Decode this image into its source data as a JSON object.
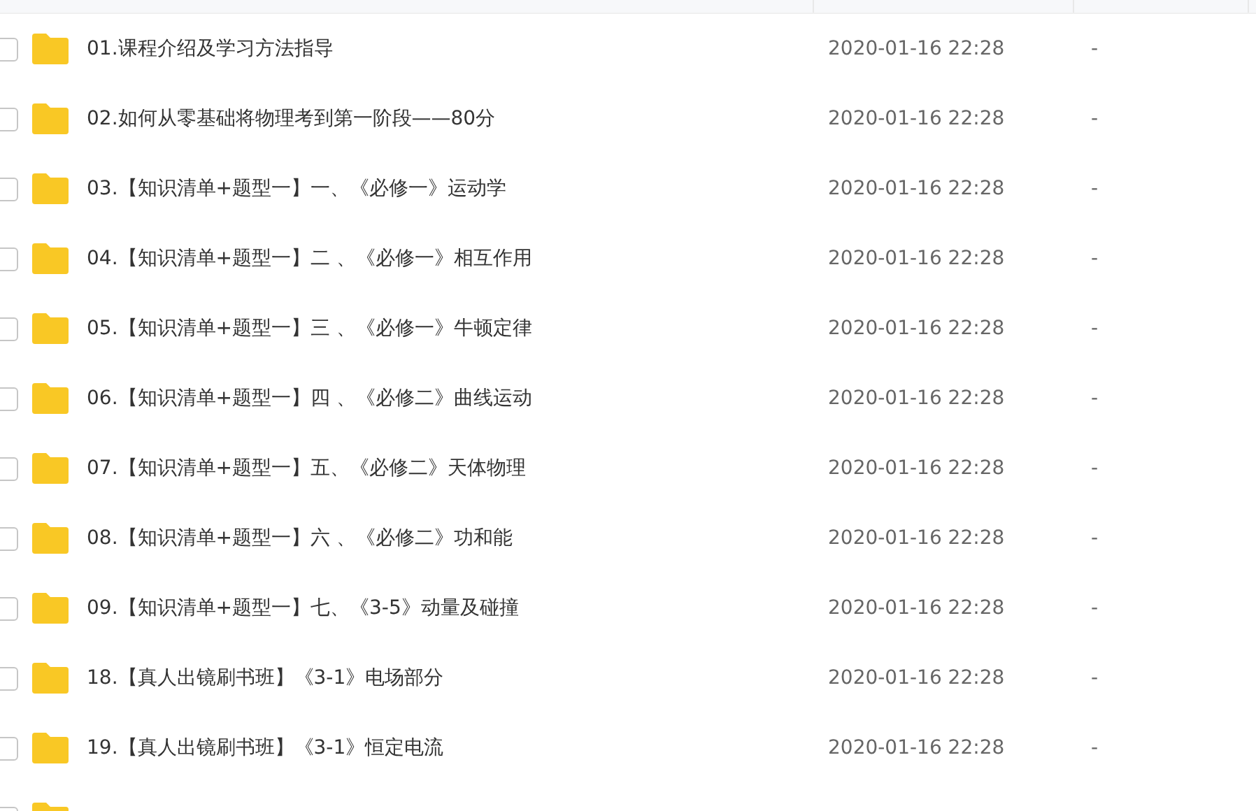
{
  "rows": [
    {
      "name": "01.课程介绍及学习方法指导",
      "modified": "2020-01-16 22:28",
      "size": "-",
      "checked": false
    },
    {
      "name": "02.如何从零基础将物理考到第一阶段——80分",
      "modified": "2020-01-16 22:28",
      "size": "-",
      "checked": false
    },
    {
      "name": "03.【知识清单+题型一】一、《必修一》运动学",
      "modified": "2020-01-16 22:28",
      "size": "-",
      "checked": false
    },
    {
      "name": "04.【知识清单+题型一】二 、《必修一》相互作用",
      "modified": "2020-01-16 22:28",
      "size": "-",
      "checked": false
    },
    {
      "name": "05.【知识清单+题型一】三 、《必修一》牛顿定律",
      "modified": "2020-01-16 22:28",
      "size": "-",
      "checked": false
    },
    {
      "name": "06.【知识清单+题型一】四 、《必修二》曲线运动",
      "modified": "2020-01-16 22:28",
      "size": "-",
      "checked": false
    },
    {
      "name": "07.【知识清单+题型一】五、《必修二》天体物理",
      "modified": "2020-01-16 22:28",
      "size": "-",
      "checked": false
    },
    {
      "name": "08.【知识清单+题型一】六 、《必修二》功和能",
      "modified": "2020-01-16 22:28",
      "size": "-",
      "checked": false
    },
    {
      "name": "09.【知识清单+题型一】七、《3-5》动量及碰撞",
      "modified": "2020-01-16 22:28",
      "size": "-",
      "checked": false
    },
    {
      "name": "18.【真人出镜刷书班】《3-1》电场部分",
      "modified": "2020-01-16 22:28",
      "size": "-",
      "checked": false
    },
    {
      "name": "19.【真人出镜刷书班】《3-1》恒定电流",
      "modified": "2020-01-16 22:28",
      "size": "-",
      "checked": false
    },
    {
      "checked": false
    }
  ]
}
